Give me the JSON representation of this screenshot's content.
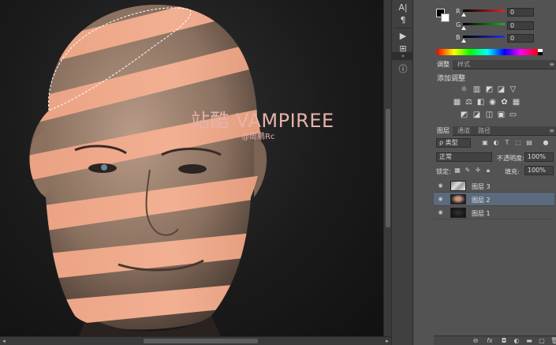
{
  "canvas": {
    "watermark_title": "站酷 VAMPIREE",
    "watermark_sub": "@周鹏Rc"
  },
  "dock": {
    "icons": [
      "character-icon",
      "paragraph-icon",
      "play-icon",
      "mixer-icon",
      "brush-preset-icon",
      "adjust-icon",
      "info-icon"
    ],
    "collapse_label": "◂▸"
  },
  "color_panel": {
    "fg": "#000000",
    "bg": "#ffffff",
    "channels": [
      {
        "label": "R",
        "value": "0",
        "color": "#e52222"
      },
      {
        "label": "G",
        "value": "0",
        "color": "#1fae1f"
      },
      {
        "label": "B",
        "value": "0",
        "color": "#2233dd"
      }
    ]
  },
  "adjust_panel": {
    "tabs": [
      "调整",
      "样式"
    ],
    "title": "添加调整"
  },
  "layers_panel": {
    "tabs": [
      "图层",
      "通道",
      "路径"
    ],
    "filter_type": "ρ 类型",
    "blend_mode": "正常",
    "opacity_label": "不透明度:",
    "opacity_value": "100%",
    "lock_label": "锁定:",
    "fill_label": "填充:",
    "fill_value": "100%",
    "layers": [
      {
        "name": "图层 3",
        "selected": false
      },
      {
        "name": "图层 2",
        "selected": true
      },
      {
        "name": "图层 1",
        "selected": false
      }
    ],
    "footer_icons": [
      "link-icon",
      "fx-icon",
      "mask-icon",
      "adjustment-layer-icon",
      "group-icon",
      "new-layer-icon",
      "trash-icon"
    ]
  }
}
